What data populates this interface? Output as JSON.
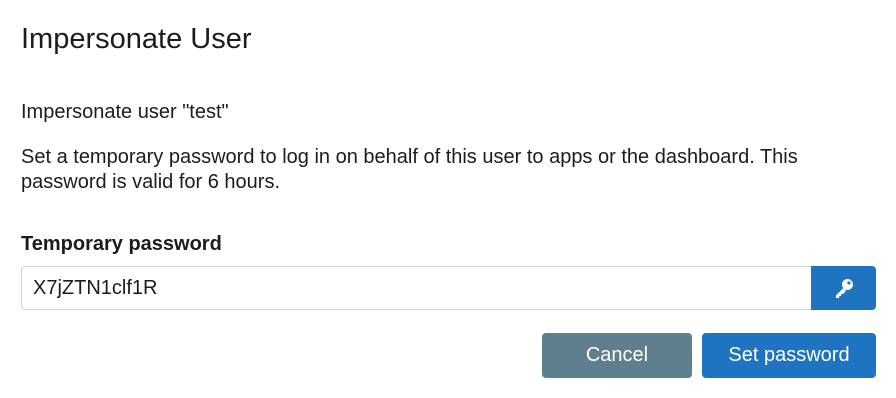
{
  "dialog": {
    "title": "Impersonate User",
    "subtitle": "Impersonate user \"test\"",
    "description": "Set a temporary password to log in on behalf of this user to apps or the dashboard. This password is valid for 6 hours."
  },
  "password_field": {
    "label": "Temporary password",
    "value": "X7jZTN1clf1R",
    "generate_icon": "key-icon"
  },
  "actions": {
    "cancel_label": "Cancel",
    "submit_label": "Set password"
  },
  "colors": {
    "primary": "#1f74c2",
    "secondary": "#5f7f8e",
    "input_border": "#cfd4d9"
  }
}
